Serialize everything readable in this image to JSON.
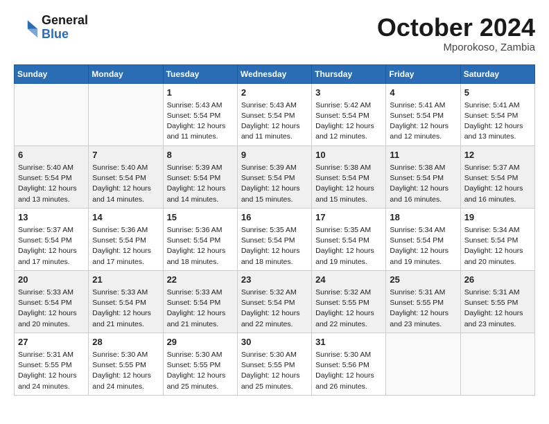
{
  "logo": {
    "general": "General",
    "blue": "Blue"
  },
  "title": "October 2024",
  "location": "Mporokoso, Zambia",
  "days_of_week": [
    "Sunday",
    "Monday",
    "Tuesday",
    "Wednesday",
    "Thursday",
    "Friday",
    "Saturday"
  ],
  "weeks": [
    [
      {
        "day": "",
        "empty": true
      },
      {
        "day": "",
        "empty": true
      },
      {
        "day": "1",
        "sunrise": "5:43 AM",
        "sunset": "5:54 PM",
        "daylight": "12 hours and 11 minutes."
      },
      {
        "day": "2",
        "sunrise": "5:43 AM",
        "sunset": "5:54 PM",
        "daylight": "12 hours and 11 minutes."
      },
      {
        "day": "3",
        "sunrise": "5:42 AM",
        "sunset": "5:54 PM",
        "daylight": "12 hours and 12 minutes."
      },
      {
        "day": "4",
        "sunrise": "5:41 AM",
        "sunset": "5:54 PM",
        "daylight": "12 hours and 12 minutes."
      },
      {
        "day": "5",
        "sunrise": "5:41 AM",
        "sunset": "5:54 PM",
        "daylight": "12 hours and 13 minutes."
      }
    ],
    [
      {
        "day": "6",
        "sunrise": "5:40 AM",
        "sunset": "5:54 PM",
        "daylight": "12 hours and 13 minutes."
      },
      {
        "day": "7",
        "sunrise": "5:40 AM",
        "sunset": "5:54 PM",
        "daylight": "12 hours and 14 minutes."
      },
      {
        "day": "8",
        "sunrise": "5:39 AM",
        "sunset": "5:54 PM",
        "daylight": "12 hours and 14 minutes."
      },
      {
        "day": "9",
        "sunrise": "5:39 AM",
        "sunset": "5:54 PM",
        "daylight": "12 hours and 15 minutes."
      },
      {
        "day": "10",
        "sunrise": "5:38 AM",
        "sunset": "5:54 PM",
        "daylight": "12 hours and 15 minutes."
      },
      {
        "day": "11",
        "sunrise": "5:38 AM",
        "sunset": "5:54 PM",
        "daylight": "12 hours and 16 minutes."
      },
      {
        "day": "12",
        "sunrise": "5:37 AM",
        "sunset": "5:54 PM",
        "daylight": "12 hours and 16 minutes."
      }
    ],
    [
      {
        "day": "13",
        "sunrise": "5:37 AM",
        "sunset": "5:54 PM",
        "daylight": "12 hours and 17 minutes."
      },
      {
        "day": "14",
        "sunrise": "5:36 AM",
        "sunset": "5:54 PM",
        "daylight": "12 hours and 17 minutes."
      },
      {
        "day": "15",
        "sunrise": "5:36 AM",
        "sunset": "5:54 PM",
        "daylight": "12 hours and 18 minutes."
      },
      {
        "day": "16",
        "sunrise": "5:35 AM",
        "sunset": "5:54 PM",
        "daylight": "12 hours and 18 minutes."
      },
      {
        "day": "17",
        "sunrise": "5:35 AM",
        "sunset": "5:54 PM",
        "daylight": "12 hours and 19 minutes."
      },
      {
        "day": "18",
        "sunrise": "5:34 AM",
        "sunset": "5:54 PM",
        "daylight": "12 hours and 19 minutes."
      },
      {
        "day": "19",
        "sunrise": "5:34 AM",
        "sunset": "5:54 PM",
        "daylight": "12 hours and 20 minutes."
      }
    ],
    [
      {
        "day": "20",
        "sunrise": "5:33 AM",
        "sunset": "5:54 PM",
        "daylight": "12 hours and 20 minutes."
      },
      {
        "day": "21",
        "sunrise": "5:33 AM",
        "sunset": "5:54 PM",
        "daylight": "12 hours and 21 minutes."
      },
      {
        "day": "22",
        "sunrise": "5:33 AM",
        "sunset": "5:54 PM",
        "daylight": "12 hours and 21 minutes."
      },
      {
        "day": "23",
        "sunrise": "5:32 AM",
        "sunset": "5:54 PM",
        "daylight": "12 hours and 22 minutes."
      },
      {
        "day": "24",
        "sunrise": "5:32 AM",
        "sunset": "5:55 PM",
        "daylight": "12 hours and 22 minutes."
      },
      {
        "day": "25",
        "sunrise": "5:31 AM",
        "sunset": "5:55 PM",
        "daylight": "12 hours and 23 minutes."
      },
      {
        "day": "26",
        "sunrise": "5:31 AM",
        "sunset": "5:55 PM",
        "daylight": "12 hours and 23 minutes."
      }
    ],
    [
      {
        "day": "27",
        "sunrise": "5:31 AM",
        "sunset": "5:55 PM",
        "daylight": "12 hours and 24 minutes."
      },
      {
        "day": "28",
        "sunrise": "5:30 AM",
        "sunset": "5:55 PM",
        "daylight": "12 hours and 24 minutes."
      },
      {
        "day": "29",
        "sunrise": "5:30 AM",
        "sunset": "5:55 PM",
        "daylight": "12 hours and 25 minutes."
      },
      {
        "day": "30",
        "sunrise": "5:30 AM",
        "sunset": "5:55 PM",
        "daylight": "12 hours and 25 minutes."
      },
      {
        "day": "31",
        "sunrise": "5:30 AM",
        "sunset": "5:56 PM",
        "daylight": "12 hours and 26 minutes."
      },
      {
        "day": "",
        "empty": true
      },
      {
        "day": "",
        "empty": true
      }
    ]
  ]
}
